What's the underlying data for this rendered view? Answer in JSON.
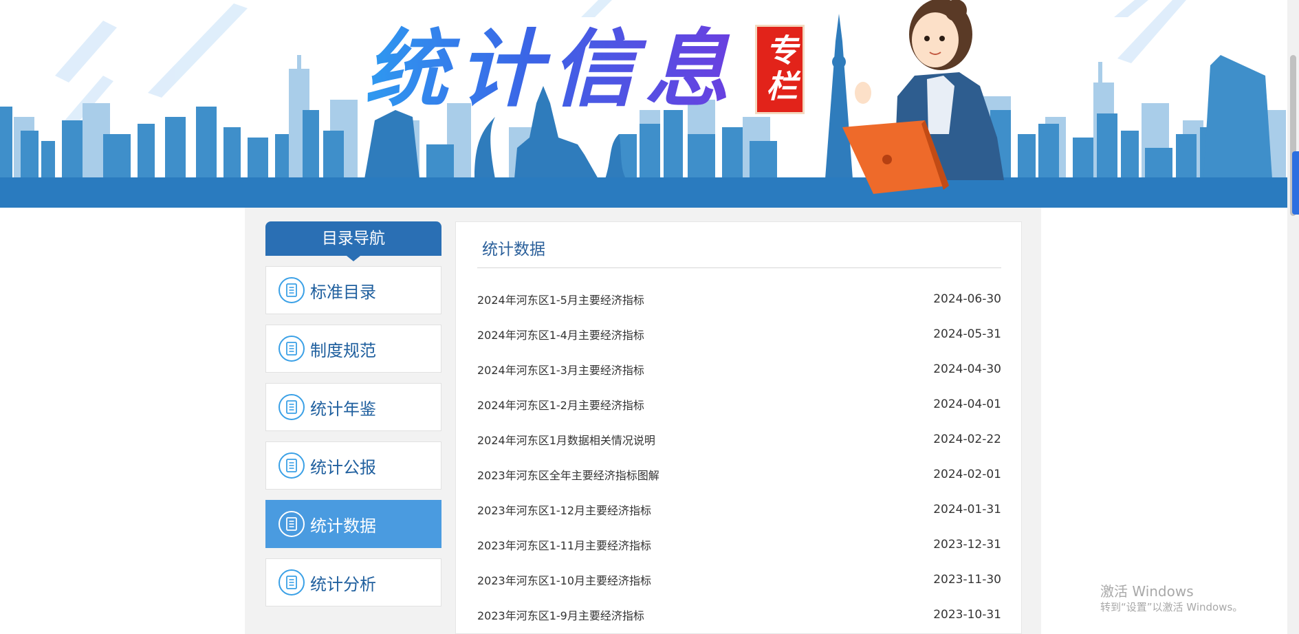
{
  "banner": {
    "title": "统计信息",
    "seal": "专栏"
  },
  "sidebar": {
    "header": "目录导航",
    "items": [
      {
        "label": "标准目录",
        "active": false
      },
      {
        "label": "制度规范",
        "active": false
      },
      {
        "label": "统计年鉴",
        "active": false
      },
      {
        "label": "统计公报",
        "active": false
      },
      {
        "label": "统计数据",
        "active": true
      },
      {
        "label": "统计分析",
        "active": false
      }
    ]
  },
  "main": {
    "title": "统计数据",
    "rows": [
      {
        "title": "2024年河东区1-5月主要经济指标",
        "date": "2024-06-30"
      },
      {
        "title": "2024年河东区1-4月主要经济指标",
        "date": "2024-05-31"
      },
      {
        "title": "2024年河东区1-3月主要经济指标",
        "date": "2024-04-30"
      },
      {
        "title": "2024年河东区1-2月主要经济指标",
        "date": "2024-04-01"
      },
      {
        "title": "2024年河东区1月数据相关情况说明",
        "date": "2024-02-22"
      },
      {
        "title": "2023年河东区全年主要经济指标图解",
        "date": "2024-02-01"
      },
      {
        "title": "2023年河东区1-12月主要经济指标",
        "date": "2024-01-31"
      },
      {
        "title": "2023年河东区1-11月主要经济指标",
        "date": "2023-12-31"
      },
      {
        "title": "2023年河东区1-10月主要经济指标",
        "date": "2023-11-30"
      },
      {
        "title": "2023年河东区1-9月主要经济指标",
        "date": "2023-10-31"
      }
    ]
  },
  "watermark": {
    "title": "激活 Windows",
    "subtitle": "转到“设置”以激活 Windows。"
  },
  "colors": {
    "banner_blue": "#2a7bbf",
    "nav_header": "#2a6fb4",
    "nav_active": "#4a9be0",
    "icon_ring": "#3aa0e6",
    "seal_red": "#e2231a",
    "laptop_orange": "#ee6a2a"
  },
  "icons": {
    "nav_item": "document-icon"
  }
}
